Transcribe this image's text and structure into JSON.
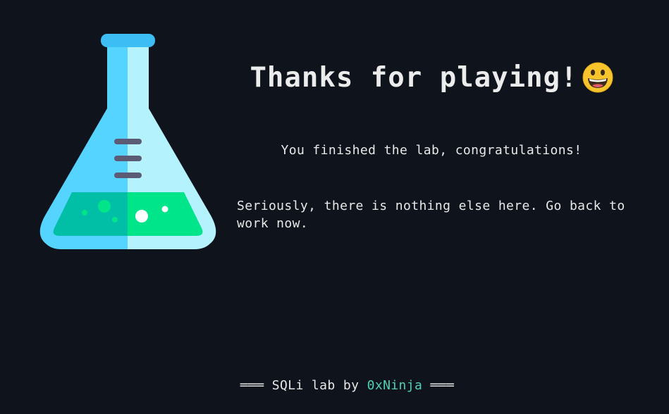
{
  "title": "Thanks for playing!",
  "emoji": "grinning-face-icon",
  "subtitle": "You finished the lab, congratulations!",
  "body": "Seriously, there is nothing else here. Go back to work now.",
  "footer": {
    "left_deco": "═══",
    "prefix": "SQLi lab by",
    "author": "0xNinja",
    "right_deco": "═══"
  },
  "colors": {
    "background": "#0e131c",
    "text": "#e8e8e8",
    "author": "#4fd1b5",
    "flask_glass_dark": "#54d4fe",
    "flask_glass_light": "#b4f2fe",
    "liquid_dark": "#00bfa6",
    "liquid_light": "#00e58a"
  }
}
